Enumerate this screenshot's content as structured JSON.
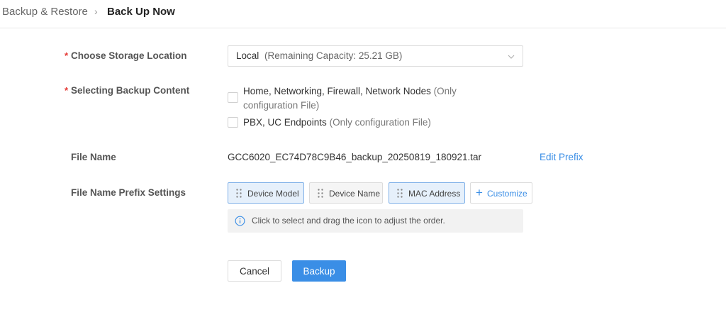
{
  "breadcrumb": {
    "parent": "Backup & Restore",
    "separator": "›",
    "current": "Back Up Now"
  },
  "form": {
    "required_mark": "*",
    "storage": {
      "label": "Choose Storage Location",
      "value": "Local",
      "capacity": "(Remaining Capacity: 25.21 GB)"
    },
    "content": {
      "label": "Selecting Backup Content",
      "options": [
        {
          "text": "Home, Networking, Firewall, Network Nodes",
          "note": "(Only configuration File)",
          "checked": false
        },
        {
          "text": "PBX, UC Endpoints",
          "note": "(Only configuration File)",
          "checked": false
        }
      ]
    },
    "file_name": {
      "label": "File Name",
      "value": "GCC6020_EC74D78C9B46_backup_20250819_180921.tar",
      "edit_link": "Edit Prefix"
    },
    "prefix": {
      "label": "File Name Prefix Settings",
      "chips": [
        {
          "label": "Device Model",
          "selected": true
        },
        {
          "label": "Device Name",
          "selected": false
        },
        {
          "label": "MAC Address",
          "selected": true
        }
      ],
      "customize": "Customize",
      "tip": "Click to select and drag the icon to adjust the order."
    }
  },
  "actions": {
    "cancel": "Cancel",
    "backup": "Backup"
  },
  "colors": {
    "primary": "#3a8ee6",
    "required": "#e53935",
    "chip_selected_bg": "#e6f0fb"
  }
}
